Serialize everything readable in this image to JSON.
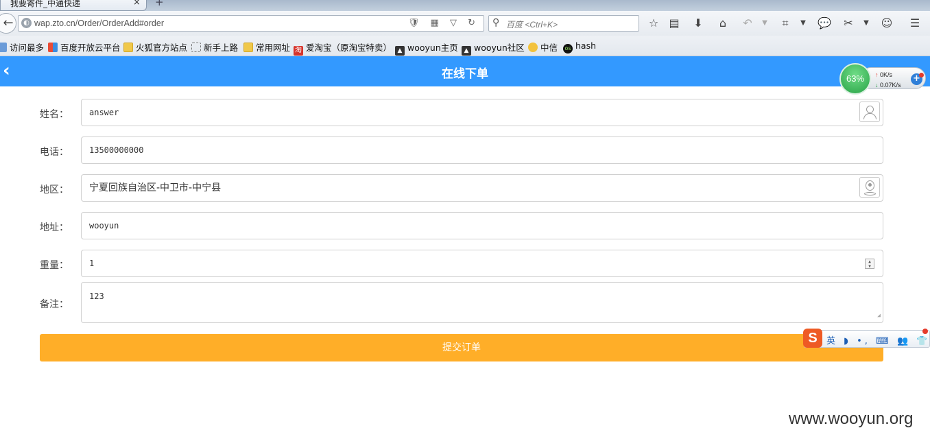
{
  "browser": {
    "tab_title": "我要寄件_中通快递",
    "tab_close": "×",
    "new_tab": "+",
    "url": "wap.zto.cn/Order/OrderAdd#order",
    "search_placeholder": "百度 <Ctrl+K>",
    "url_icons": "🛡 ▦ ▽ ↻"
  },
  "bookmarks": [
    {
      "label": "访问最多",
      "icon": "chart-icon"
    },
    {
      "label": "百度开放云平台",
      "icon": "baidu-icon"
    },
    {
      "label": "火狐官方站点",
      "icon": "folder-icon"
    },
    {
      "label": "新手上路",
      "icon": "dashed-page-icon"
    },
    {
      "label": "常用网址",
      "icon": "folder-icon"
    },
    {
      "label": "爱淘宝（原淘宝特卖）",
      "icon": "taobao-icon"
    },
    {
      "label": "wooyun主页",
      "icon": "wooyun-icon"
    },
    {
      "label": "wooyun社区",
      "icon": "wooyun-icon"
    },
    {
      "label": "中信",
      "icon": "citic-icon"
    },
    {
      "label": "hash",
      "icon": "os-icon"
    }
  ],
  "header": {
    "back_glyph": "‹",
    "title": "在线下单"
  },
  "network_widget": {
    "percent": "63%",
    "up": "0K/s",
    "down": "0.07K/s"
  },
  "form": {
    "name": {
      "label": "姓名：",
      "value": "answer"
    },
    "phone": {
      "label": "电话：",
      "value": "13500000000"
    },
    "region": {
      "label": "地区：",
      "value": "宁夏回族自治区-中卫市-中宁县"
    },
    "address": {
      "label": "地址：",
      "value": "wooyun"
    },
    "weight": {
      "label": "重量：",
      "value": "1"
    },
    "remark": {
      "label": "备注：",
      "value": "123"
    },
    "submit_label": "提交订单"
  },
  "ime": {
    "logo": "S",
    "items": "英 ◗ •, ⌨ 👥 👕 🔧"
  },
  "watermark": "www.wooyun.org",
  "colors": {
    "header_blue": "#3399ff",
    "submit_orange": "#ffae28"
  }
}
